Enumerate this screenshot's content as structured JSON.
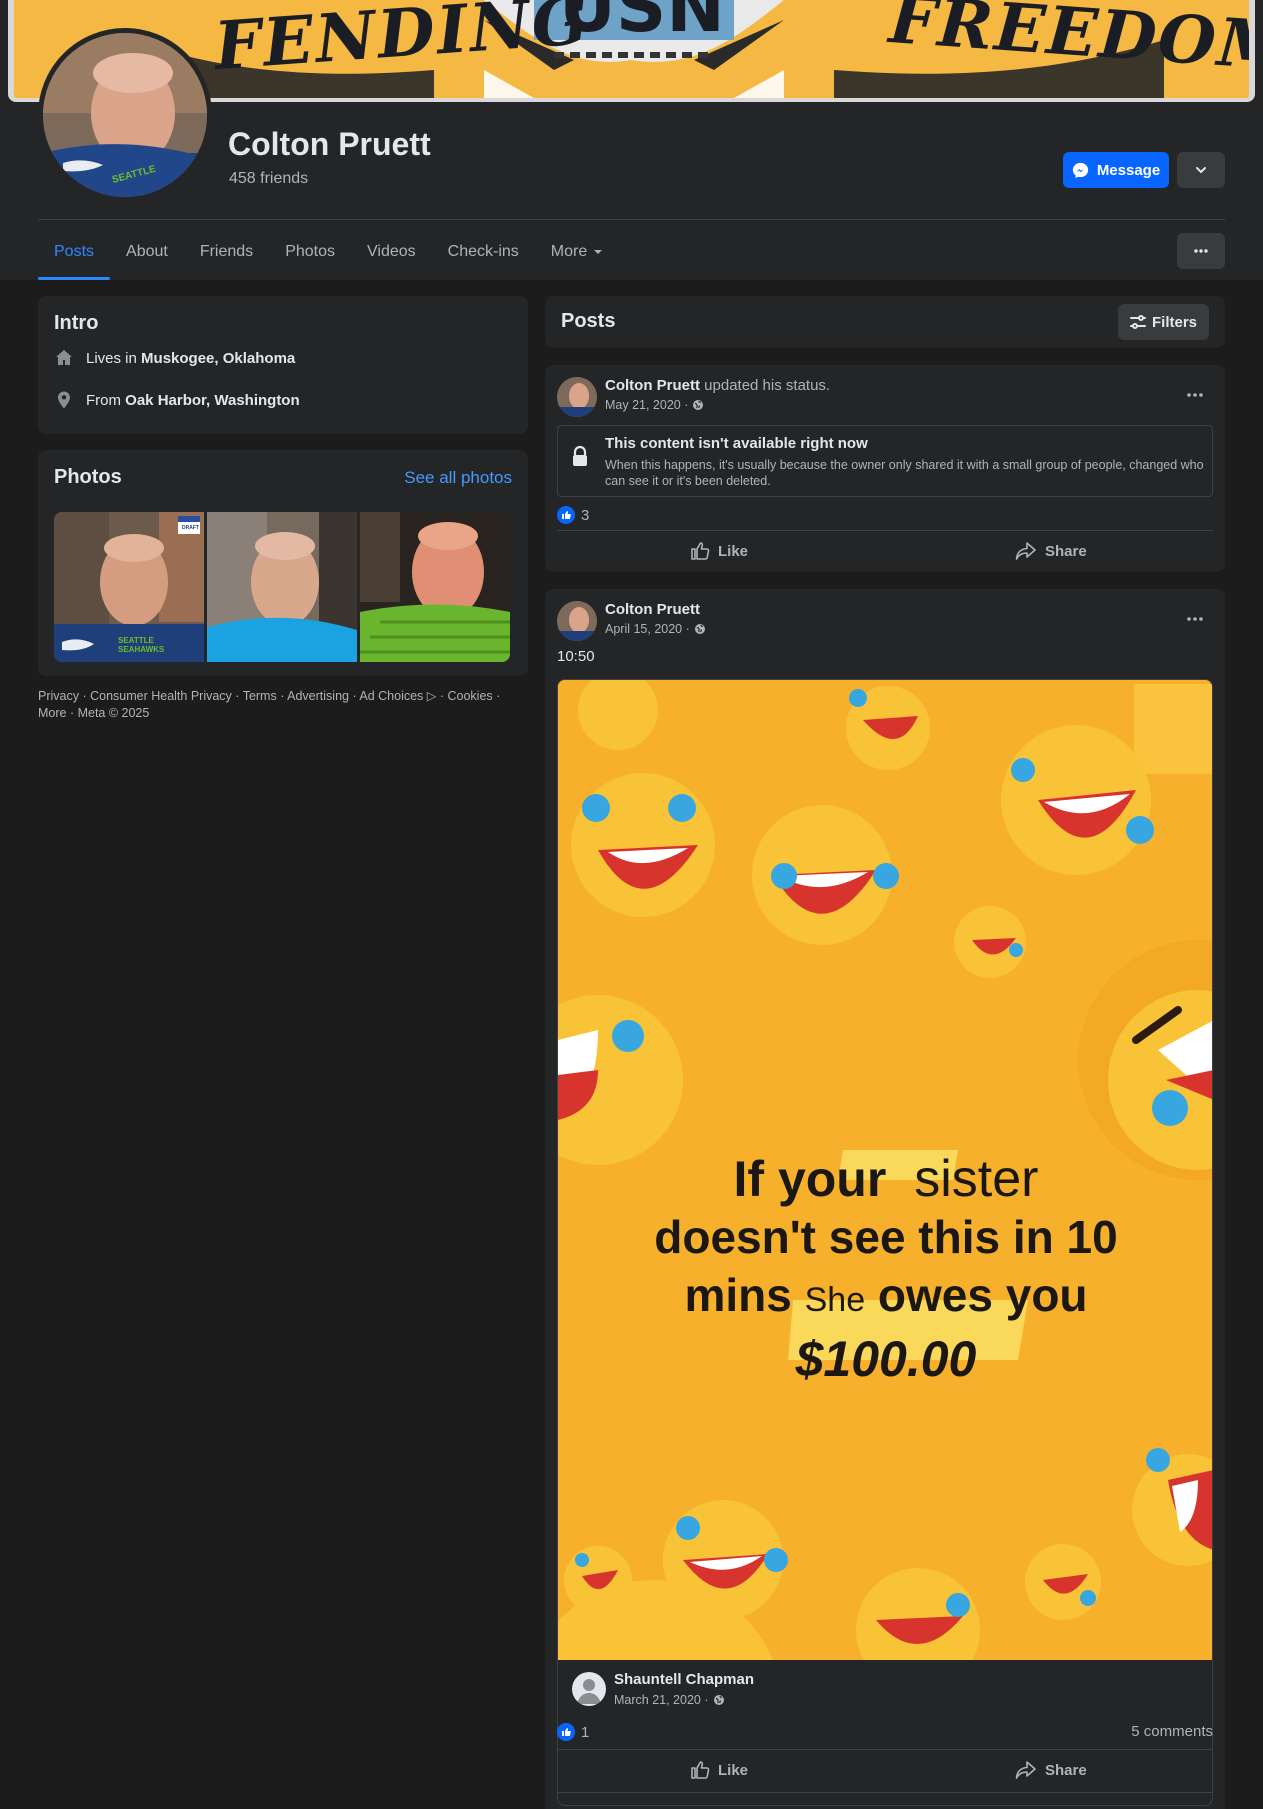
{
  "profile": {
    "name": "Colton Pruett",
    "friends": "458 friends",
    "message_label": "Message",
    "cover_text_left": "FENDING",
    "cover_text_mid": "USN",
    "cover_text_right": "FREEDOM"
  },
  "tabs": [
    {
      "label": "Posts",
      "active": true
    },
    {
      "label": "About"
    },
    {
      "label": "Friends"
    },
    {
      "label": "Photos"
    },
    {
      "label": "Videos"
    },
    {
      "label": "Check-ins"
    },
    {
      "label": "More"
    }
  ],
  "intro": {
    "title": "Intro",
    "lives_prefix": "Lives in ",
    "lives_place": "Muskogee, Oklahoma",
    "from_prefix": "From ",
    "from_place": "Oak Harbor, Washington"
  },
  "photos": {
    "title": "Photos",
    "see_all": "See all photos",
    "badge_text": "DRAFT",
    "shirt_text": "SEATTLE SEAHAWKS"
  },
  "footer": {
    "text": "Privacy · Consumer Health Privacy · Terms · Advertising · Ad Choices ▷ · Cookies · More · Meta © 2025"
  },
  "posts_header": {
    "title": "Posts",
    "filters_label": "Filters"
  },
  "post1": {
    "author": "Colton Pruett",
    "action": " updated his status.",
    "date": "May 21, 2020 ·",
    "unavailable_title": "This content isn't available right now",
    "unavailable_body": "When this happens, it's usually because the owner only shared it with a small group of people, changed who can see it or it's been deleted.",
    "like_count": "3",
    "like_label": "Like",
    "share_label": "Share"
  },
  "post2": {
    "author": "Colton Pruett",
    "date": "April 15, 2020 ·",
    "text": "10:50",
    "meme_line1_a": "If your",
    "meme_line1_b": "sister",
    "meme_line2": "doesn't see this in 10",
    "meme_line3_a": "mins",
    "meme_line3_b": "She",
    "meme_line3_c": "owes you",
    "meme_line4": "$100.00",
    "shared_author": "Shauntell Chapman",
    "shared_date": "March 21, 2020 ·",
    "like_count": "1",
    "comments": "5 comments",
    "like_label": "Like",
    "share_label": "Share"
  },
  "colors": {
    "background": "#1c1c1d",
    "card": "#242526",
    "accent": "#0866ff",
    "link": "#4599ff"
  },
  "icons": [
    "messenger-icon",
    "chevron-down-icon",
    "more-dots-icon",
    "home-icon",
    "location-pin-icon",
    "filters-icon",
    "globe-icon",
    "lock-icon",
    "like-icon",
    "share-icon",
    "like-reaction-icon",
    "default-avatar-icon"
  ]
}
